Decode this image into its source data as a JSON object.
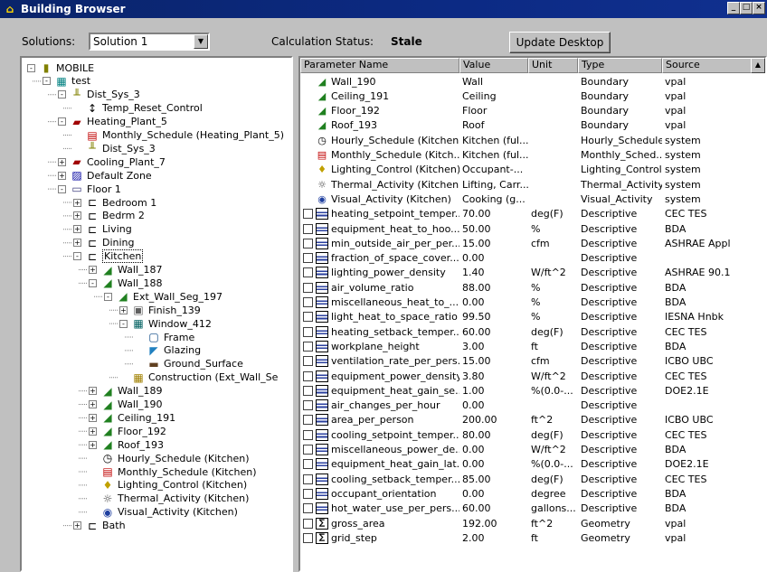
{
  "window": {
    "title": "Building Browser",
    "min": "_",
    "max": "□",
    "close": "×"
  },
  "toolbar": {
    "solutions_label": "Solutions:",
    "solution_value": "Solution 1",
    "calc_status_label": "Calculation Status:",
    "calc_status_value": "Stale",
    "update_button": "Update Desktop"
  },
  "tree": [
    {
      "label": "MOBILE",
      "depth": 0,
      "exp": "-",
      "icon": "building-icon"
    },
    {
      "label": "test",
      "depth": 1,
      "exp": "-",
      "icon": "grid-icon"
    },
    {
      "label": "Dist_Sys_3",
      "depth": 2,
      "exp": "-",
      "icon": "dist-system-icon"
    },
    {
      "label": "Temp_Reset_Control",
      "depth": 3,
      "exp": "",
      "icon": "control-icon"
    },
    {
      "label": "Heating_Plant_5",
      "depth": 2,
      "exp": "-",
      "icon": "plant-icon"
    },
    {
      "label": "Monthly_Schedule (Heating_Plant_5)",
      "depth": 3,
      "exp": "",
      "icon": "calendar-icon"
    },
    {
      "label": "Dist_Sys_3",
      "depth": 3,
      "exp": "",
      "icon": "dist-system-icon"
    },
    {
      "label": "Cooling_Plant_7",
      "depth": 2,
      "exp": "+",
      "icon": "plant-icon"
    },
    {
      "label": "Default Zone",
      "depth": 2,
      "exp": "+",
      "icon": "zone-icon"
    },
    {
      "label": "Floor 1",
      "depth": 2,
      "exp": "-",
      "icon": "floor-icon"
    },
    {
      "label": "Bedroom 1",
      "depth": 3,
      "exp": "+",
      "icon": "space-icon"
    },
    {
      "label": "Bedrm 2",
      "depth": 3,
      "exp": "+",
      "icon": "space-icon"
    },
    {
      "label": "Living",
      "depth": 3,
      "exp": "+",
      "icon": "space-icon"
    },
    {
      "label": "Dining",
      "depth": 3,
      "exp": "+",
      "icon": "space-icon"
    },
    {
      "label": "Kitchen",
      "depth": 3,
      "exp": "-",
      "icon": "space-icon",
      "selected": true
    },
    {
      "label": "Wall_187",
      "depth": 4,
      "exp": "+",
      "icon": "wall-icon"
    },
    {
      "label": "Wall_188",
      "depth": 4,
      "exp": "-",
      "icon": "wall-icon"
    },
    {
      "label": "Ext_Wall_Seg_197",
      "depth": 5,
      "exp": "-",
      "icon": "wall-icon"
    },
    {
      "label": "Finish_139",
      "depth": 6,
      "exp": "+",
      "icon": "finish-icon"
    },
    {
      "label": "Window_412",
      "depth": 6,
      "exp": "-",
      "icon": "window-icon"
    },
    {
      "label": "Frame",
      "depth": 7,
      "exp": "",
      "icon": "frame-icon"
    },
    {
      "label": "Glazing",
      "depth": 7,
      "exp": "",
      "icon": "glazing-icon"
    },
    {
      "label": "Ground_Surface",
      "depth": 7,
      "exp": "",
      "icon": "ground-icon"
    },
    {
      "label": "Construction (Ext_Wall_Se",
      "depth": 6,
      "exp": "",
      "icon": "construction-icon"
    },
    {
      "label": "Wall_189",
      "depth": 4,
      "exp": "+",
      "icon": "wall-icon"
    },
    {
      "label": "Wall_190",
      "depth": 4,
      "exp": "+",
      "icon": "wall-icon"
    },
    {
      "label": "Ceiling_191",
      "depth": 4,
      "exp": "+",
      "icon": "wall-icon"
    },
    {
      "label": "Floor_192",
      "depth": 4,
      "exp": "+",
      "icon": "wall-icon"
    },
    {
      "label": "Roof_193",
      "depth": 4,
      "exp": "+",
      "icon": "wall-icon"
    },
    {
      "label": "Hourly_Schedule (Kitchen)",
      "depth": 4,
      "exp": "",
      "icon": "clock-icon"
    },
    {
      "label": "Monthly_Schedule (Kitchen)",
      "depth": 4,
      "exp": "",
      "icon": "calendar-icon"
    },
    {
      "label": "Lighting_Control (Kitchen)",
      "depth": 4,
      "exp": "",
      "icon": "lighting-icon"
    },
    {
      "label": "Thermal_Activity (Kitchen)",
      "depth": 4,
      "exp": "",
      "icon": "thermal-icon"
    },
    {
      "label": "Visual_Activity (Kitchen)",
      "depth": 4,
      "exp": "",
      "icon": "eye-icon"
    },
    {
      "label": "Bath",
      "depth": 3,
      "exp": "+",
      "icon": "space-icon"
    }
  ],
  "grid": {
    "columns": [
      "Parameter Name",
      "Value",
      "Unit",
      "Type",
      "Source"
    ],
    "rows": [
      {
        "check": false,
        "icon": "wall-icon",
        "name": "Wall_190",
        "value": "Wall",
        "unit": "",
        "type": "Boundary",
        "source": "vpal"
      },
      {
        "check": false,
        "icon": "wall-icon",
        "name": "Ceiling_191",
        "value": "Ceiling",
        "unit": "",
        "type": "Boundary",
        "source": "vpal"
      },
      {
        "check": false,
        "icon": "wall-icon",
        "name": "Floor_192",
        "value": "Floor",
        "unit": "",
        "type": "Boundary",
        "source": "vpal"
      },
      {
        "check": false,
        "icon": "wall-icon",
        "name": "Roof_193",
        "value": "Roof",
        "unit": "",
        "type": "Boundary",
        "source": "vpal"
      },
      {
        "check": false,
        "icon": "clock-icon",
        "name": "Hourly_Schedule (Kitchen)",
        "value": "Kitchen (ful...",
        "unit": "",
        "type": "Hourly_Schedule",
        "source": "system"
      },
      {
        "check": false,
        "icon": "calendar-icon",
        "name": "Monthly_Schedule (Kitch...",
        "value": "Kitchen (ful...",
        "unit": "",
        "type": "Monthly_Sched...",
        "source": "system"
      },
      {
        "check": false,
        "icon": "lighting-icon",
        "name": "Lighting_Control (Kitchen)",
        "value": "Occupant-...",
        "unit": "",
        "type": "Lighting_Control",
        "source": "system"
      },
      {
        "check": false,
        "icon": "thermal-icon",
        "name": "Thermal_Activity (Kitchen)",
        "value": "Lifting, Carr...",
        "unit": "",
        "type": "Thermal_Activity",
        "source": "system"
      },
      {
        "check": false,
        "icon": "eye-icon",
        "name": "Visual_Activity (Kitchen)",
        "value": "Cooking (g...",
        "unit": "",
        "type": "Visual_Activity",
        "source": "system"
      },
      {
        "check": true,
        "icon": "doc",
        "name": "heating_setpoint_temper...",
        "value": "70.00",
        "unit": "deg(F)",
        "type": "Descriptive",
        "source": "CEC TES"
      },
      {
        "check": true,
        "icon": "doc",
        "name": "equipment_heat_to_hoo...",
        "value": "50.00",
        "unit": "%",
        "type": "Descriptive",
        "source": "BDA"
      },
      {
        "check": true,
        "icon": "doc",
        "name": "min_outside_air_per_per...",
        "value": "15.00",
        "unit": "cfm",
        "type": "Descriptive",
        "source": "ASHRAE Appl"
      },
      {
        "check": true,
        "icon": "doc",
        "name": "fraction_of_space_cover...",
        "value": "0.00",
        "unit": "",
        "type": "Descriptive",
        "source": ""
      },
      {
        "check": true,
        "icon": "doc",
        "name": "lighting_power_density",
        "value": "1.40",
        "unit": "W/ft^2",
        "type": "Descriptive",
        "source": "ASHRAE 90.1"
      },
      {
        "check": true,
        "icon": "doc",
        "name": "air_volume_ratio",
        "value": "88.00",
        "unit": "%",
        "type": "Descriptive",
        "source": "BDA"
      },
      {
        "check": true,
        "icon": "doc",
        "name": "miscellaneous_heat_to_...",
        "value": "0.00",
        "unit": "%",
        "type": "Descriptive",
        "source": "BDA"
      },
      {
        "check": true,
        "icon": "doc",
        "name": "light_heat_to_space_ratio",
        "value": "99.50",
        "unit": "%",
        "type": "Descriptive",
        "source": "IESNA Hnbk"
      },
      {
        "check": true,
        "icon": "doc",
        "name": "heating_setback_temper...",
        "value": "60.00",
        "unit": "deg(F)",
        "type": "Descriptive",
        "source": "CEC TES"
      },
      {
        "check": true,
        "icon": "doc",
        "name": "workplane_height",
        "value": "3.00",
        "unit": "ft",
        "type": "Descriptive",
        "source": "BDA"
      },
      {
        "check": true,
        "icon": "doc",
        "name": "ventilation_rate_per_pers...",
        "value": "15.00",
        "unit": "cfm",
        "type": "Descriptive",
        "source": "ICBO UBC"
      },
      {
        "check": true,
        "icon": "doc",
        "name": "equipment_power_density",
        "value": "3.80",
        "unit": "W/ft^2",
        "type": "Descriptive",
        "source": "CEC TES"
      },
      {
        "check": true,
        "icon": "doc",
        "name": "equipment_heat_gain_se...",
        "value": "1.00",
        "unit": "%(0.0-...",
        "type": "Descriptive",
        "source": "DOE2.1E"
      },
      {
        "check": true,
        "icon": "doc",
        "name": "air_changes_per_hour",
        "value": "0.00",
        "unit": "",
        "type": "Descriptive",
        "source": ""
      },
      {
        "check": true,
        "icon": "doc",
        "name": "area_per_person",
        "value": "200.00",
        "unit": "ft^2",
        "type": "Descriptive",
        "source": "ICBO UBC"
      },
      {
        "check": true,
        "icon": "doc",
        "name": "cooling_setpoint_temper...",
        "value": "80.00",
        "unit": "deg(F)",
        "type": "Descriptive",
        "source": "CEC TES"
      },
      {
        "check": true,
        "icon": "doc",
        "name": "miscellaneous_power_de...",
        "value": "0.00",
        "unit": "W/ft^2",
        "type": "Descriptive",
        "source": "BDA"
      },
      {
        "check": true,
        "icon": "doc",
        "name": "equipment_heat_gain_lat...",
        "value": "0.00",
        "unit": "%(0.0-...",
        "type": "Descriptive",
        "source": "DOE2.1E"
      },
      {
        "check": true,
        "icon": "doc",
        "name": "cooling_setback_temper...",
        "value": "85.00",
        "unit": "deg(F)",
        "type": "Descriptive",
        "source": "CEC TES"
      },
      {
        "check": true,
        "icon": "doc",
        "name": "occupant_orientation",
        "value": "0.00",
        "unit": "degree",
        "type": "Descriptive",
        "source": "BDA"
      },
      {
        "check": true,
        "icon": "doc",
        "name": "hot_water_use_per_pers...",
        "value": "60.00",
        "unit": "gallons...",
        "type": "Descriptive",
        "source": "BDA"
      },
      {
        "check": true,
        "icon": "geo",
        "name": "gross_area",
        "value": "192.00",
        "unit": "ft^2",
        "type": "Geometry",
        "source": "vpal"
      },
      {
        "check": true,
        "icon": "geo",
        "name": "grid_step",
        "value": "2.00",
        "unit": "ft",
        "type": "Geometry",
        "source": "vpal"
      }
    ]
  }
}
